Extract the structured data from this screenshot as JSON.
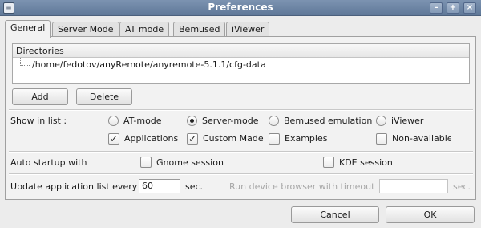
{
  "window": {
    "title": "Preferences"
  },
  "titlebar": {
    "menu_glyph": "≡",
    "minimize_glyph": "–",
    "maximize_glyph": "+",
    "close_glyph": "×"
  },
  "tabs": [
    {
      "label": "General",
      "active": true
    },
    {
      "label": "Server Mode",
      "active": false
    },
    {
      "label": "AT mode",
      "active": false
    },
    {
      "label": "Bemused",
      "active": false
    },
    {
      "label": "iViewer",
      "active": false
    }
  ],
  "directories": {
    "header": "Directories",
    "items": [
      "/home/fedotov/anyRemote/anyremote-5.1.1/cfg-data"
    ]
  },
  "buttons": {
    "add": "Add",
    "delete": "Delete",
    "cancel": "Cancel",
    "ok": "OK"
  },
  "show_in_list": {
    "label": "Show in list :",
    "radios": [
      {
        "label": "AT-mode",
        "selected": false
      },
      {
        "label": "Server-mode",
        "selected": true
      },
      {
        "label": "Bemused emulation",
        "selected": false
      },
      {
        "label": "iViewer",
        "selected": false
      }
    ],
    "checks": [
      {
        "label": "Applications",
        "checked": true
      },
      {
        "label": "Custom Made",
        "checked": true
      },
      {
        "label": "Examples",
        "checked": false
      },
      {
        "label": "Non-available",
        "checked": false
      }
    ]
  },
  "auto_startup": {
    "label": "Auto startup with",
    "gnome": {
      "label": "Gnome session",
      "checked": false
    },
    "kde": {
      "label": "KDE session",
      "checked": false
    }
  },
  "update": {
    "label": "Update application list every",
    "value": "60",
    "unit": "sec.",
    "browser_label": "Run device browser with timeout",
    "browser_value": "",
    "browser_unit": "sec."
  },
  "icons": {
    "check_glyph": "✓"
  }
}
